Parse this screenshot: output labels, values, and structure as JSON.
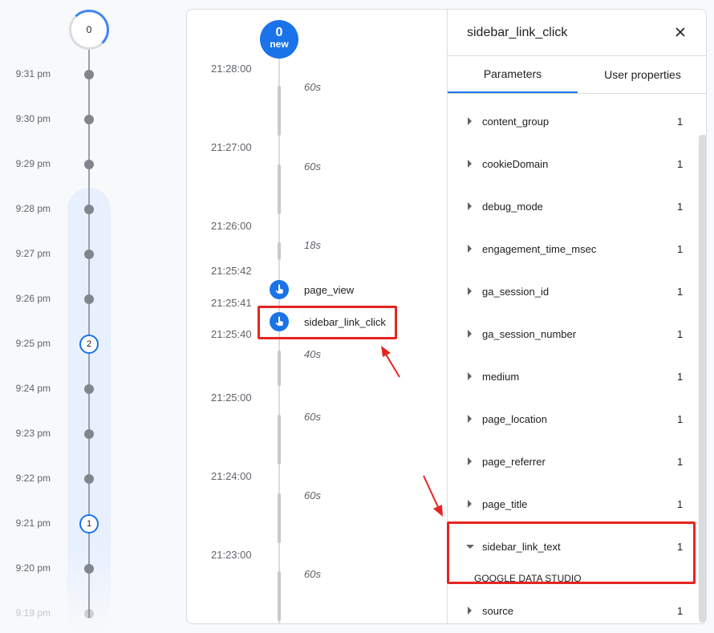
{
  "minute_timeline": {
    "top_count": "0",
    "rows": [
      {
        "time": "9:31 pm",
        "badge": ""
      },
      {
        "time": "9:30 pm",
        "badge": ""
      },
      {
        "time": "9:29 pm",
        "badge": ""
      },
      {
        "time": "9:28 pm",
        "badge": ""
      },
      {
        "time": "9:27 pm",
        "badge": ""
      },
      {
        "time": "9:26 pm",
        "badge": ""
      },
      {
        "time": "9:25 pm",
        "badge": "2"
      },
      {
        "time": "9:24 pm",
        "badge": ""
      },
      {
        "time": "9:23 pm",
        "badge": ""
      },
      {
        "time": "9:22 pm",
        "badge": ""
      },
      {
        "time": "9:21 pm",
        "badge": "1"
      },
      {
        "time": "9:20 pm",
        "badge": ""
      },
      {
        "time": "9:19 pm",
        "badge": ""
      }
    ]
  },
  "stream": {
    "new_count": "0",
    "new_label": "new",
    "timestamps": [
      "21:28:00",
      "21:27:00",
      "21:26:00",
      "21:25:42",
      "21:25:41",
      "21:25:40",
      "21:25:00",
      "21:24:00",
      "21:23:00"
    ],
    "durations": [
      "60s",
      "60s",
      "18s",
      "40s",
      "60s",
      "60s",
      "60s"
    ],
    "events": [
      {
        "label": "page_view"
      },
      {
        "label": "sidebar_link_click"
      }
    ]
  },
  "panel": {
    "title": "sidebar_link_click",
    "tabs": [
      "Parameters",
      "User properties"
    ],
    "params": [
      {
        "name": "content_group",
        "count": "1"
      },
      {
        "name": "cookieDomain",
        "count": "1"
      },
      {
        "name": "debug_mode",
        "count": "1"
      },
      {
        "name": "engagement_time_msec",
        "count": "1"
      },
      {
        "name": "ga_session_id",
        "count": "1"
      },
      {
        "name": "ga_session_number",
        "count": "1"
      },
      {
        "name": "medium",
        "count": "1"
      },
      {
        "name": "page_location",
        "count": "1"
      },
      {
        "name": "page_referrer",
        "count": "1"
      },
      {
        "name": "page_title",
        "count": "1"
      },
      {
        "name": "sidebar_link_text",
        "count": "1",
        "value": "GOOGLE DATA STUDIO"
      },
      {
        "name": "source",
        "count": "1"
      }
    ]
  },
  "colors": {
    "accent": "#1a73e8",
    "highlight": "#e52521"
  }
}
